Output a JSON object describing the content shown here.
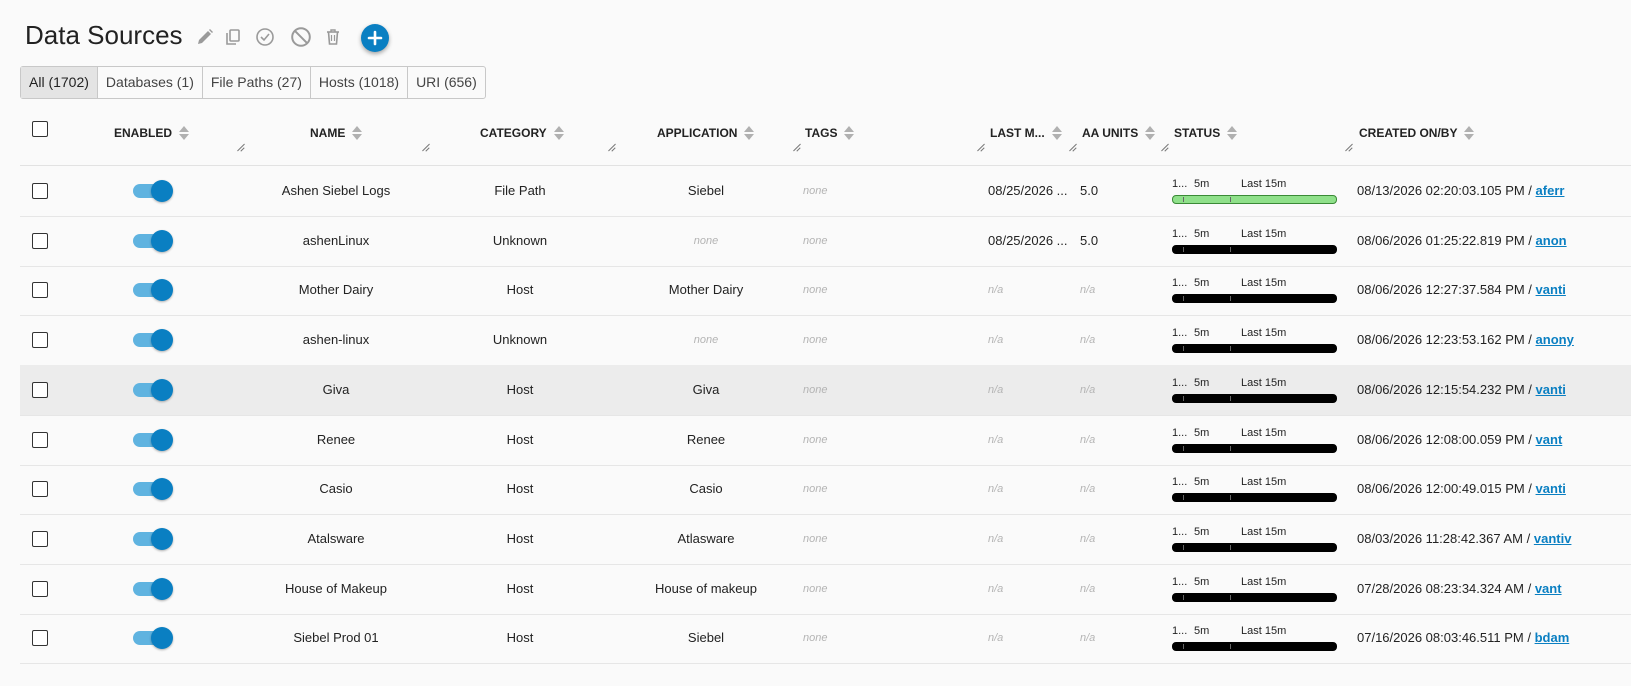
{
  "page": {
    "title": "Data Sources"
  },
  "toolbar": {
    "icons": [
      "pencil-icon",
      "copy-icon",
      "check-circle-icon",
      "block-icon",
      "trash-icon",
      "plus-icon"
    ]
  },
  "tabs": [
    {
      "label": "All (1702)",
      "active": true
    },
    {
      "label": "Databases (1)",
      "active": false
    },
    {
      "label": "File Paths (27)",
      "active": false
    },
    {
      "label": "Hosts (1018)",
      "active": false
    },
    {
      "label": "URI (656)",
      "active": false
    }
  ],
  "columns": {
    "enabled": "ENABLED",
    "name": "NAME",
    "category": "CATEGORY",
    "application": "APPLICATION",
    "tags": "TAGS",
    "last_modified": "LAST M...",
    "aa_units": "AA UNITS",
    "status": "STATUS",
    "created": "CREATED ON/BY"
  },
  "status_labels": {
    "first": "1...",
    "mid": "5m",
    "last": "Last 15m"
  },
  "rows": [
    {
      "name": "Ashen Siebel Logs",
      "category": "File Path",
      "application": "Siebel",
      "tags": "none",
      "last_modified": "08/25/2026 ...",
      "aa_units": "5.0",
      "status": "ok",
      "created": "08/13/2026 02:20:03.105 PM /",
      "by": "aferr"
    },
    {
      "name": "ashenLinux",
      "category": "Unknown",
      "application": "none",
      "tags": "none",
      "last_modified": "08/25/2026 ...",
      "aa_units": "5.0",
      "status": "off",
      "created": "08/06/2026 01:25:22.819 PM /",
      "by": "anon"
    },
    {
      "name": "Mother Dairy",
      "category": "Host",
      "application": "Mother Dairy",
      "tags": "none",
      "last_modified": "n/a",
      "aa_units": "n/a",
      "status": "off",
      "created": "08/06/2026 12:27:37.584 PM /",
      "by": "vanti"
    },
    {
      "name": "ashen-linux",
      "category": "Unknown",
      "application": "none",
      "tags": "none",
      "last_modified": "n/a",
      "aa_units": "n/a",
      "status": "off",
      "created": "08/06/2026 12:23:53.162 PM /",
      "by": "anony"
    },
    {
      "name": "Giva",
      "category": "Host",
      "application": "Giva",
      "tags": "none",
      "last_modified": "n/a",
      "aa_units": "n/a",
      "status": "off",
      "created": "08/06/2026 12:15:54.232 PM /",
      "by": "vanti"
    },
    {
      "name": "Renee",
      "category": "Host",
      "application": "Renee",
      "tags": "none",
      "last_modified": "n/a",
      "aa_units": "n/a",
      "status": "off",
      "created": "08/06/2026 12:08:00.059 PM /",
      "by": "vant"
    },
    {
      "name": "Casio",
      "category": "Host",
      "application": "Casio",
      "tags": "none",
      "last_modified": "n/a",
      "aa_units": "n/a",
      "status": "off",
      "created": "08/06/2026 12:00:49.015 PM /",
      "by": "vanti"
    },
    {
      "name": "Atalsware",
      "category": "Host",
      "application": "Atlasware",
      "tags": "none",
      "last_modified": "n/a",
      "aa_units": "n/a",
      "status": "off",
      "created": "08/03/2026 11:28:42.367 AM /",
      "by": "vantiv"
    },
    {
      "name": "House of Makeup",
      "category": "Host",
      "application": "House of makeup",
      "tags": "none",
      "last_modified": "n/a",
      "aa_units": "n/a",
      "status": "off",
      "created": "07/28/2026 08:23:34.324 AM /",
      "by": "vant"
    },
    {
      "name": "Siebel Prod 01",
      "category": "Host",
      "application": "Siebel",
      "tags": "none",
      "last_modified": "n/a",
      "aa_units": "n/a",
      "status": "off",
      "created": "07/16/2026 08:03:46.511 PM /",
      "by": "bdam"
    }
  ],
  "colors": {
    "accent": "#0a7fc2",
    "toggle_track": "#5fb3e0",
    "status_ok": "#8fe08a"
  }
}
